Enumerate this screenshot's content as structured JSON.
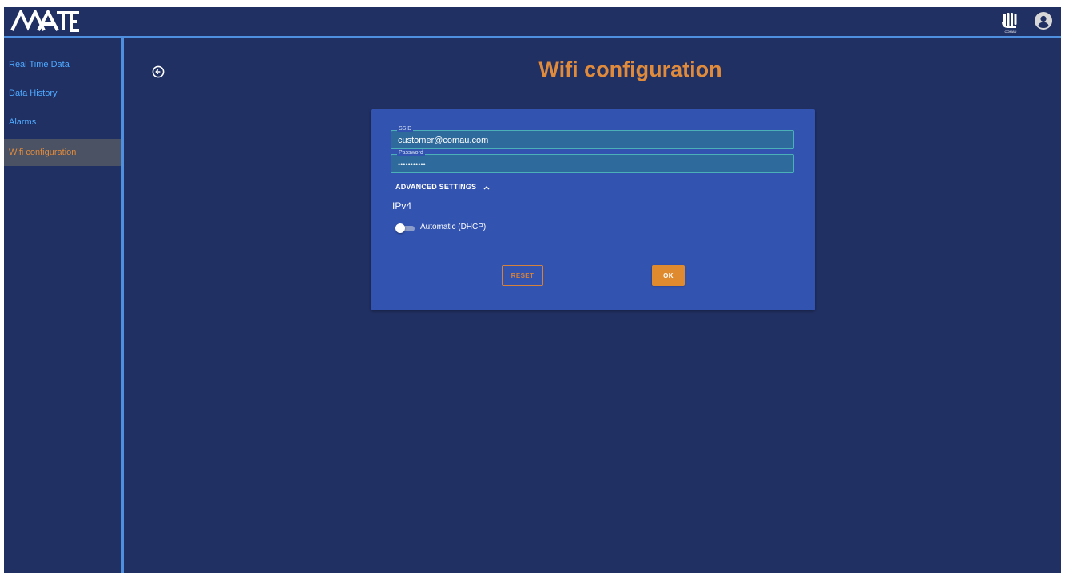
{
  "app": {
    "logo_text": "MATE",
    "brand_logo_text": "COMAU"
  },
  "sidebar": {
    "items": [
      {
        "label": "Real Time Data",
        "active": false
      },
      {
        "label": "Data History",
        "active": false
      },
      {
        "label": "Alarms",
        "active": false
      },
      {
        "label": "Wifi configuration",
        "active": true
      }
    ]
  },
  "main": {
    "title": "Wifi configuration",
    "form": {
      "ssid": {
        "label": "SSID",
        "value": "customer@comau.com"
      },
      "password": {
        "label": "Password",
        "value": "•••••••••••"
      },
      "advanced_settings_label": "ADVANCED SETTINGS",
      "advanced_expanded": true,
      "ipv4_label": "IPv4",
      "dhcp": {
        "label": "Automatic (DHCP)",
        "enabled": false
      },
      "reset_label": "RESET",
      "ok_label": "OK"
    }
  },
  "colors": {
    "background": "#213063",
    "accent_blue": "#4f8fe0",
    "accent_orange": "#e08a3c",
    "card": "#3253b0"
  },
  "icons": {
    "back": "arrow-circle-left-icon",
    "user": "user-circle-icon",
    "advanced": "chevron-up-icon"
  }
}
